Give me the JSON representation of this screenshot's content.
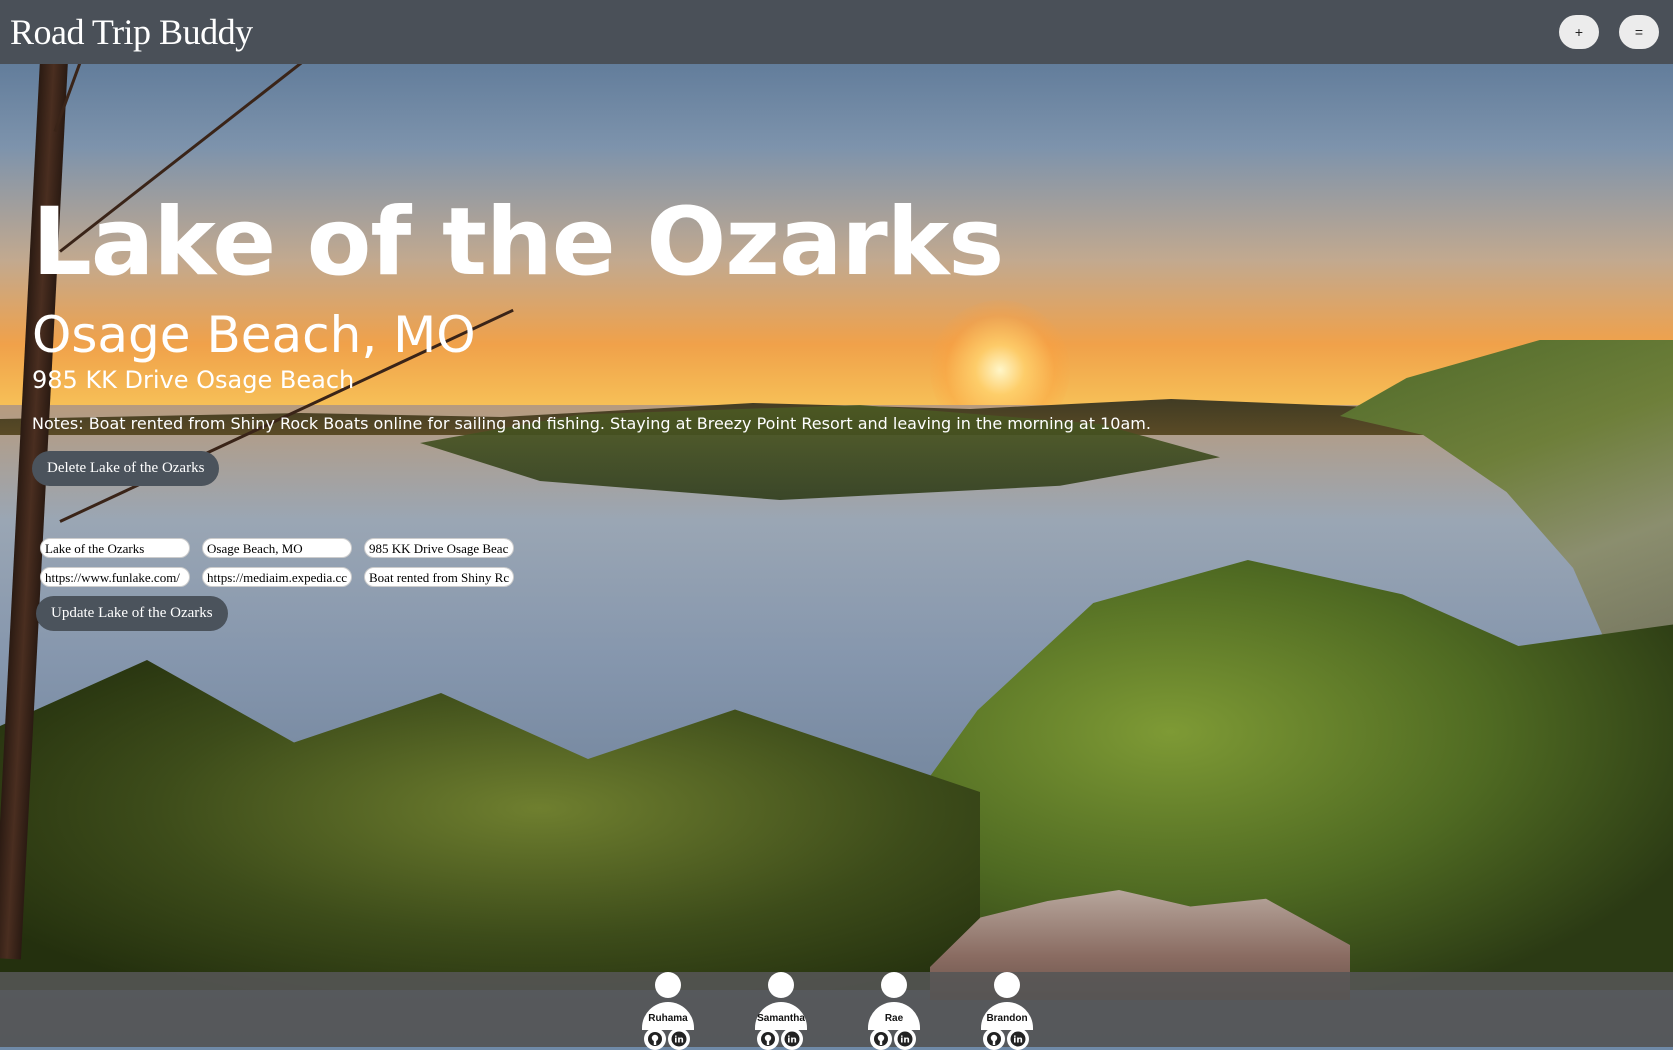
{
  "header": {
    "brand": "Road Trip Buddy",
    "add_label": "+",
    "menu_label": "="
  },
  "trip": {
    "title": "Lake of the Ozarks",
    "city": "Osage Beach, MO",
    "address": "985 KK Drive Osage Beach",
    "notes": "Notes: Boat rented from Shiny Rock Boats online for sailing and fishing. Staying at Breezy Point Resort and leaving in the morning at 10am.",
    "delete_label": "Delete Lake of the Ozarks"
  },
  "edit_form": {
    "name_value": "Lake of the Ozarks",
    "city_value": "Osage Beach, MO",
    "address_value": "985 KK Drive Osage Beac",
    "website_value": "https://www.funlake.com/",
    "image_value": "https://mediaim.expedia.cc",
    "notes_value": "Boat rented from Shiny Rc",
    "update_label": "Update Lake of the Ozarks"
  },
  "footer": {
    "members": [
      {
        "name": "Ruhama"
      },
      {
        "name": "Samantha"
      },
      {
        "name": "Rae"
      },
      {
        "name": "Brandon"
      }
    ],
    "icons": [
      "github-icon",
      "linkedin-icon"
    ]
  },
  "colors": {
    "header_bg": "#4a5058",
    "button_bg": "#4b535c",
    "footer_bg": "#555555"
  }
}
